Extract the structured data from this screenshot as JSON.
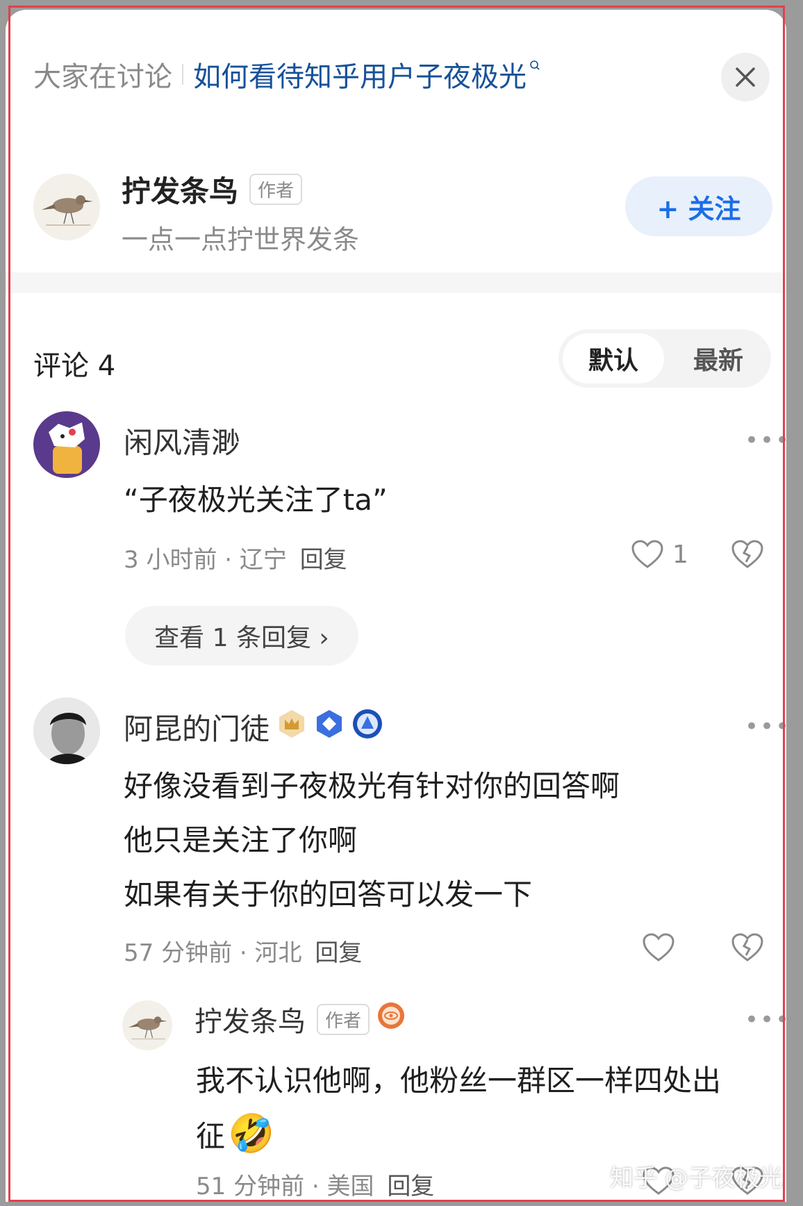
{
  "header": {
    "topic_label": "大家在讨论",
    "topic_title": "如何看待知乎用户子夜极光",
    "search_icon": "search-icon",
    "close_icon": "close-icon"
  },
  "author": {
    "name": "拧发条鸟",
    "badge": "作者",
    "bio": "一点一点拧世界发条",
    "follow_label": "+ 关注"
  },
  "comments_header": {
    "title": "评论 4",
    "sort_default": "默认",
    "sort_newest": "最新"
  },
  "comments": [
    {
      "name": "闲风清渺",
      "text_lines": [
        "“子夜极光关注了ta”"
      ],
      "time": "3 小时前 · 辽宁",
      "reply": "回复",
      "likes": "1",
      "view_replies": "查看 1 条回复 ›"
    },
    {
      "name": "阿昆的门徒",
      "badges": [
        "crown-badge-icon",
        "blue-diamond-badge-icon",
        "blue-circle-badge-icon"
      ],
      "text_lines": [
        "好像没看到子夜极光有针对你的回答啊",
        "他只是关注了你啊",
        "如果有关于你的回答可以发一下"
      ],
      "time": "57 分钟前 · 河北",
      "reply": "回复",
      "likes": ""
    },
    {
      "name": "拧发条鸟",
      "badge": "作者",
      "badge_icon": "orange-eye-badge-icon",
      "text_lines": [
        "我不认识他啊，他粉丝一群区一样四处出",
        "征"
      ],
      "emoji": "🤣",
      "time": "51 分钟前 · 美国",
      "reply": "回复"
    }
  ],
  "watermark": "知乎 @子夜极光",
  "colors": {
    "link_blue": "#175199",
    "follow_blue": "#1a6ee8",
    "frame_red": "#e0424c"
  }
}
